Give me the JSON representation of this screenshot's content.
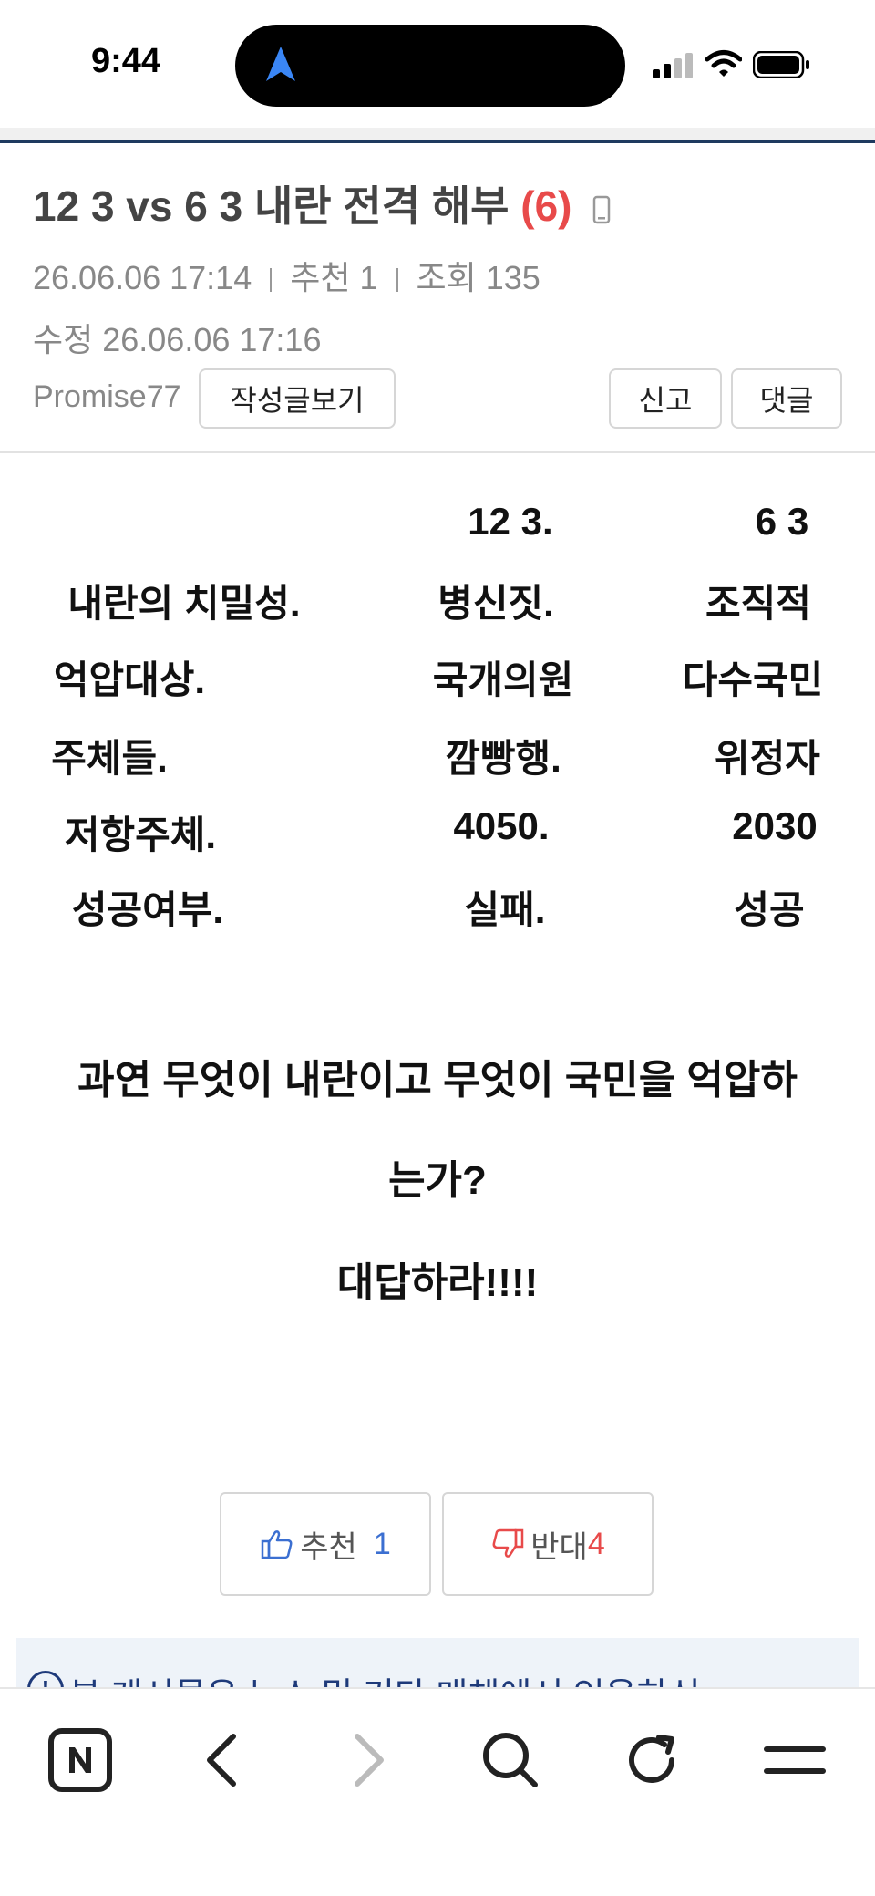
{
  "status_bar": {
    "time": "9:44"
  },
  "post": {
    "title": "12 3 vs 6 3 내란 전격 해부",
    "comment_count": "(6)",
    "date": "26.06.06  17:14",
    "recommend": "추천 1",
    "views": "조회 135",
    "edited": "수정 26.06.06  17:16",
    "author": "Promise77",
    "view_posts_label": "작성글보기",
    "report_label": "신고",
    "comment_label": "댓글"
  },
  "table": {
    "headers": [
      "",
      "12 3.",
      "6 3"
    ],
    "rows": [
      [
        "내란의 치밀성.",
        "병신짓.",
        "조직적"
      ],
      [
        "억압대상.",
        "국개의원",
        "다수국민"
      ],
      [
        "주체들.",
        "깜빵행.",
        "위정자"
      ],
      [
        "저항주체.",
        "4050.",
        "2030"
      ],
      [
        "성공여부.",
        "실패.",
        "성공"
      ]
    ]
  },
  "body": {
    "line1": "과연 무엇이 내란이고 무엇이 국민을 억압하",
    "line2": "는가?",
    "line3": "대답하라!!!!"
  },
  "votes": {
    "up_label": "추천",
    "up_count": "1",
    "down_label": "반대",
    "down_count": "4"
  },
  "notice": {
    "text": "본 게시물은 뉴스 및 기타 매체에서 인용하신"
  },
  "bottom_nav": {
    "icons": [
      "naver-icon",
      "back-icon",
      "forward-icon",
      "search-icon",
      "refresh-icon",
      "menu-icon"
    ]
  },
  "colors": {
    "accent_red": "#e84a4a",
    "accent_blue": "#3b6fd1",
    "title_rule": "#1e3a5f"
  }
}
